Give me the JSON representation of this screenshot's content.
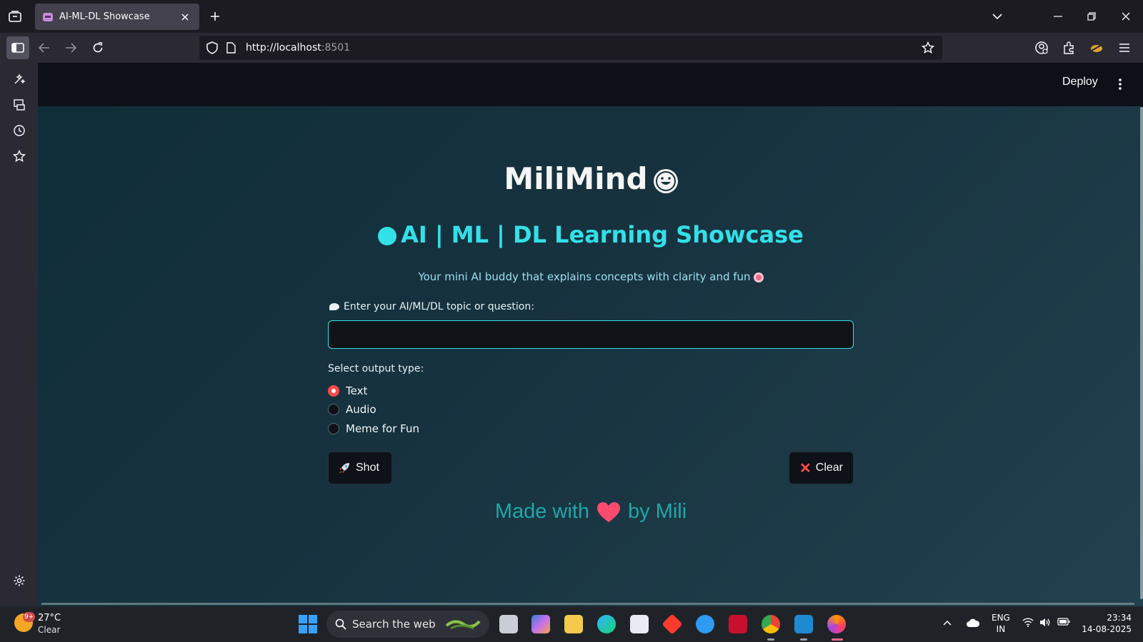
{
  "browser": {
    "tab_title": "AI-ML-DL Showcase",
    "url_host": "http://localhost",
    "url_port": ":8501"
  },
  "app_header": {
    "deploy_label": "Deploy"
  },
  "main": {
    "brand": "MiliMind",
    "showcase_title": "AI | ML | DL Learning Showcase",
    "tagline": "Your mini AI buddy that explains concepts with clarity and fun",
    "input_label": "Enter your AI/ML/DL topic or question:",
    "input_value": "",
    "radio_label": "Select output type:",
    "options": [
      {
        "label": "Text",
        "selected": true
      },
      {
        "label": "Audio",
        "selected": false
      },
      {
        "label": "Meme for Fun",
        "selected": false
      }
    ],
    "shot_label": "Shot",
    "clear_label": "Clear",
    "footer_left": "Made with",
    "footer_right": "by Mili",
    "accent_color": "#33e0e8",
    "radio_color": "#ff4b4b"
  },
  "taskbar": {
    "weather_badge": "9+",
    "temperature": "27°C",
    "condition": "Clear",
    "search_text": "Search the web",
    "lang_top": "ENG",
    "lang_bottom": "IN",
    "time": "23:34",
    "date": "14-08-2025"
  },
  "icons": {
    "tab_favicon": "streamlit-favicon",
    "heart": "red-heart-emoji",
    "rocket": "rocket-emoji",
    "target": "direct-hit-emoji"
  }
}
